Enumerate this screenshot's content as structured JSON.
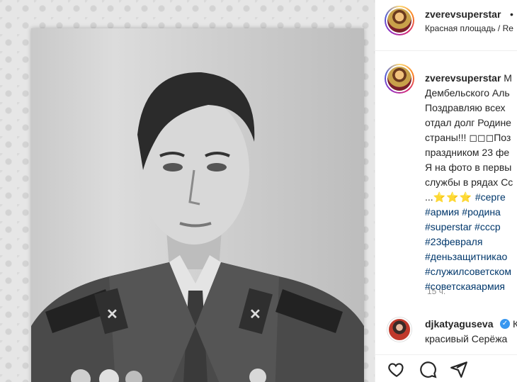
{
  "post": {
    "author": "zverevsuperstar",
    "separator": "•",
    "location": "Красная площадь / Re",
    "time_ago": "15 ч."
  },
  "caption": {
    "username": "zverevsuperstar",
    "lines": [
      "М",
      "Дембельского Аль",
      "Поздравляю всех",
      "отдал долг Родине",
      "страны!!! ◻◻◻Поз",
      "праздником 23 фе",
      "Я на фото в первы",
      "службы в рядах Сс"
    ],
    "ellipsis": "...",
    "stars": "⭐⭐⭐",
    "hashtags": [
      "#серге",
      "#армия",
      "#родина",
      "#superstar",
      "#ссср",
      "#23февраля",
      "#деньзащитникао",
      "#служилсоветском",
      "#советскаяармия"
    ]
  },
  "comment": {
    "username": "djkatyaguseva",
    "verified_mark": "✓",
    "trail": "К",
    "text": "красивый Серёжа"
  },
  "icons": {
    "like": "heart-icon",
    "comment": "comment-icon",
    "share": "paper-plane-icon"
  },
  "colors": {
    "hashtag": "#00376b",
    "verified": "#3897f0",
    "text": "#262626",
    "secondary": "#8e8e8e"
  }
}
